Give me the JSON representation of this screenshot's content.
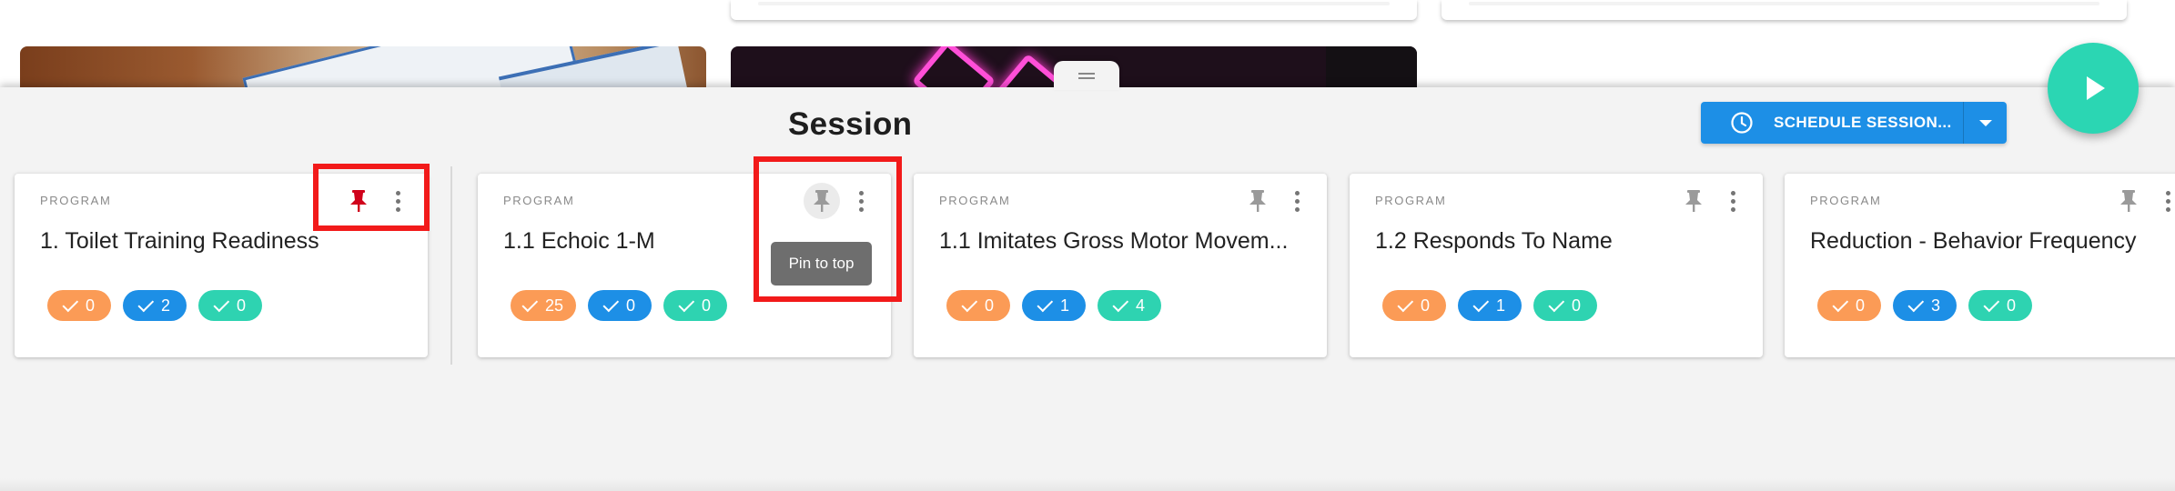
{
  "drawer": {
    "title": "Session",
    "schedule_button_label": "SCHEDULE SESSION...",
    "tooltip": "Pin to top"
  },
  "icons": {
    "fab": "play-icon",
    "schedule": "clock-icon",
    "schedule_dropdown": "caret-down-icon",
    "pin": "pin-icon",
    "more": "more-vertical-icon",
    "chip": "check-icon",
    "drag_handle": "drag-handle-icon"
  },
  "colors": {
    "pinned": "#d0021b",
    "unpinned": "#9a9a9a",
    "primary": "#1d8fe6",
    "fab": "#2bd6b3",
    "chip_orange": "#fb9b56",
    "chip_blue": "#1d8fe6",
    "chip_teal": "#2ed3b1",
    "highlight": "#f21a1a"
  },
  "cards": [
    {
      "kicker": "PROGRAM",
      "title": "1. Toilet Training Readiness",
      "pinned": true,
      "counts": [
        "0",
        "2",
        "0"
      ]
    },
    {
      "kicker": "PROGRAM",
      "title": "1.1 Echoic 1-M",
      "pinned": false,
      "counts": [
        "25",
        "0",
        "0"
      ]
    },
    {
      "kicker": "PROGRAM",
      "title": "1.1 Imitates Gross Motor Movem...",
      "pinned": false,
      "counts": [
        "0",
        "1",
        "4"
      ]
    },
    {
      "kicker": "PROGRAM",
      "title": "1.2 Responds To Name",
      "pinned": false,
      "counts": [
        "0",
        "1",
        "0"
      ]
    },
    {
      "kicker": "PROGRAM",
      "title": "Reduction - Behavior Frequency",
      "pinned": false,
      "counts": [
        "0",
        "3",
        "0"
      ]
    }
  ]
}
